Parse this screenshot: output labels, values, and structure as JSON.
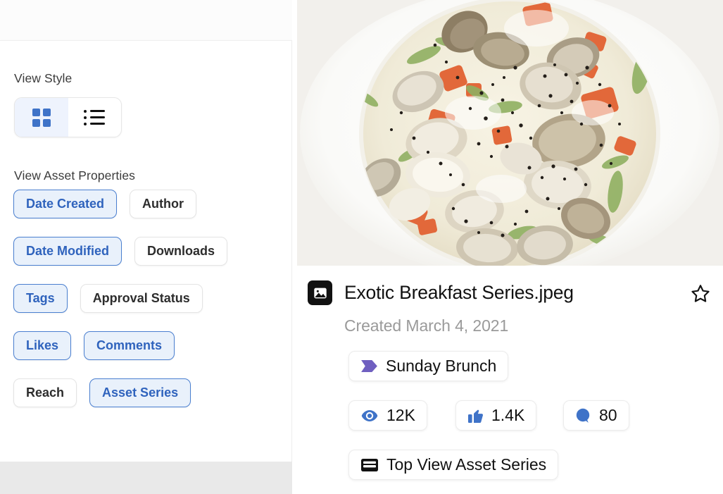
{
  "left_panel": {
    "view_style": {
      "label": "View Style",
      "options": [
        {
          "name": "grid",
          "icon": "grid-icon",
          "selected": true
        },
        {
          "name": "list",
          "icon": "list-icon",
          "selected": false
        }
      ]
    },
    "view_asset_properties": {
      "label": "View Asset Properties",
      "chips": [
        {
          "label": "Date Created",
          "selected": true
        },
        {
          "label": "Author",
          "selected": false
        },
        {
          "label": "Date Modified",
          "selected": true
        },
        {
          "label": "Downloads",
          "selected": false
        },
        {
          "label": "Tags",
          "selected": true
        },
        {
          "label": "Approval Status",
          "selected": false
        },
        {
          "label": "Likes",
          "selected": true
        },
        {
          "label": "Comments",
          "selected": true
        },
        {
          "label": "Reach",
          "selected": false
        },
        {
          "label": "Asset Series",
          "selected": true
        }
      ]
    }
  },
  "asset": {
    "file_icon": "image-file-icon",
    "title": "Exotic Breakfast Series.jpeg",
    "created": "Created March 4, 2021",
    "favorite_icon": "star-outline-icon",
    "favorited": false,
    "tag": {
      "icon": "tag-flag-icon",
      "label": "Sunday Brunch",
      "color": "#6f5fc0"
    },
    "stats": [
      {
        "icon": "eye-icon",
        "label": "12K"
      },
      {
        "icon": "thumbs-up-icon",
        "label": "1.4K"
      },
      {
        "icon": "comment-icon",
        "label": "80"
      }
    ],
    "series": {
      "icon": "asset-series-icon",
      "label": "Top View Asset Series"
    },
    "preview_alt": "Clam chowder soup in a white bowl"
  },
  "colors": {
    "accent_blue": "#3f73c8",
    "chip_selected_bg": "#e9f1fb",
    "chip_selected_border": "#4a7fd0",
    "chip_selected_text": "#2f63bd",
    "tag_purple": "#6f5fc0",
    "icon_dark": "#111111",
    "muted_text": "#9a9a9a"
  }
}
